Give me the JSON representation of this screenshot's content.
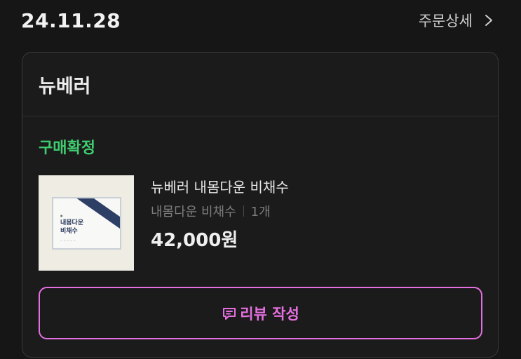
{
  "order": {
    "date": "24.11.28",
    "detail_label": "주문상세",
    "detail_icon": "chevron-right-icon"
  },
  "card": {
    "store_name": "뉴베러",
    "status": "구매확정",
    "status_color": "#3fce6f",
    "product": {
      "name": "뉴베러 내몸다운 비채수",
      "option": "내몸다운 비채수",
      "quantity": "1개",
      "price": "42,000원",
      "thumbnail": {
        "title_line1": "내몸다운",
        "title_line2": "비채수"
      }
    },
    "review_button": {
      "label": "리뷰 작성",
      "icon": "review-chat-icon",
      "color": "#e56fe0"
    }
  }
}
